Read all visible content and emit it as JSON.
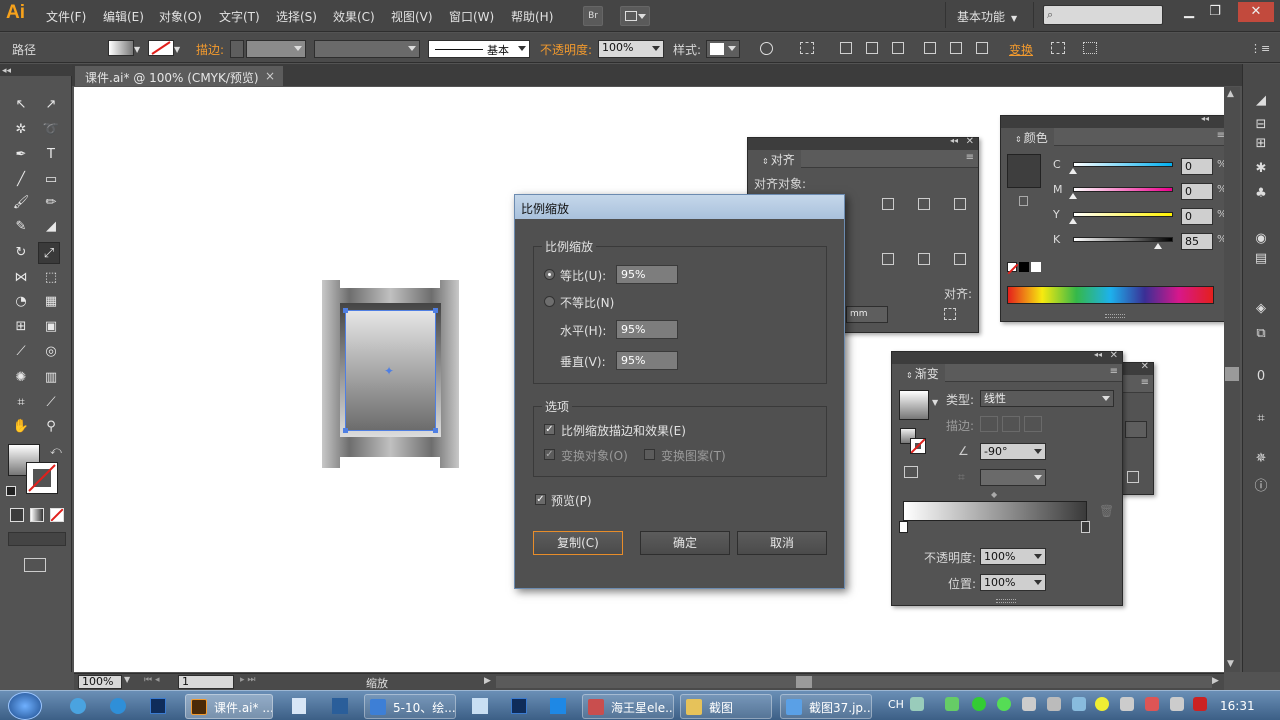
{
  "app": {
    "logo": "Ai",
    "bridge_label": "Br"
  },
  "menu": [
    "文件(F)",
    "编辑(E)",
    "对象(O)",
    "文字(T)",
    "选择(S)",
    "效果(C)",
    "视图(V)",
    "窗口(W)",
    "帮助(H)"
  ],
  "workspace": {
    "label": "基本功能",
    "search_placeholder": ""
  },
  "control_bar": {
    "object_type": "路径",
    "stroke_label": "描边",
    "stroke_style": "基本",
    "opacity_label": "不透明度",
    "opacity_value": "100%",
    "style_label": "样式",
    "transform_label": "变换"
  },
  "document_tab": {
    "title": "课件.ai* @ 100% (CMYK/预览)",
    "close": "×"
  },
  "align_panel": {
    "title": "对齐",
    "align_objects_label": "对齐对象:",
    "align_to_label": "对齐:",
    "spacing_value": "mm"
  },
  "color_panel": {
    "title": "颜色",
    "channels": [
      {
        "name": "C",
        "value": "0",
        "unit": "%",
        "fraction": 0.0
      },
      {
        "name": "M",
        "value": "0",
        "unit": "%",
        "fraction": 0.0
      },
      {
        "name": "Y",
        "value": "0",
        "unit": "%",
        "fraction": 0.0
      },
      {
        "name": "K",
        "value": "85",
        "unit": "%",
        "fraction": 0.85
      }
    ]
  },
  "gradient_panel": {
    "title": "渐变",
    "type_label": "类型:",
    "type_value": "线性",
    "stroke_label": "描边:",
    "angle_value": "-90°",
    "opacity_label": "不透明度:",
    "opacity_value": "100%",
    "position_label": "位置:",
    "position_value": "100%"
  },
  "scale_dialog": {
    "title": "比例缩放",
    "scale_group": "比例缩放",
    "uniform_label": "等比(U):",
    "uniform_value": "95%",
    "nonuniform_label": "不等比(N)",
    "horizontal_label": "水平(H):",
    "horizontal_value": "95%",
    "vertical_label": "垂直(V):",
    "vertical_value": "95%",
    "options_group": "选项",
    "scale_strokes_label": "比例缩放描边和效果(E)",
    "transform_objects_label": "变换对象(O)",
    "transform_patterns_label": "变换图案(T)",
    "preview_label": "预览(P)",
    "copy_button": "复制(C)",
    "ok_button": "确定",
    "cancel_button": "取消"
  },
  "status_bar": {
    "zoom": "100%",
    "artboard": "1",
    "status_text": "缩放"
  },
  "taskbar": {
    "tasks": [
      {
        "label": "课件.ai* ...",
        "icon_color": "#f29a2e"
      },
      {
        "label": "5-10、绘...",
        "icon_color": "#3d7fd6"
      },
      {
        "label": "海王星ele...",
        "icon_color": "#c94e4e"
      },
      {
        "label": "截图",
        "icon_color": "#e6c25a"
      },
      {
        "label": "截图37.jp...",
        "icon_color": "#5aa0e6"
      }
    ],
    "ime": "CH",
    "clock": "16:31"
  }
}
